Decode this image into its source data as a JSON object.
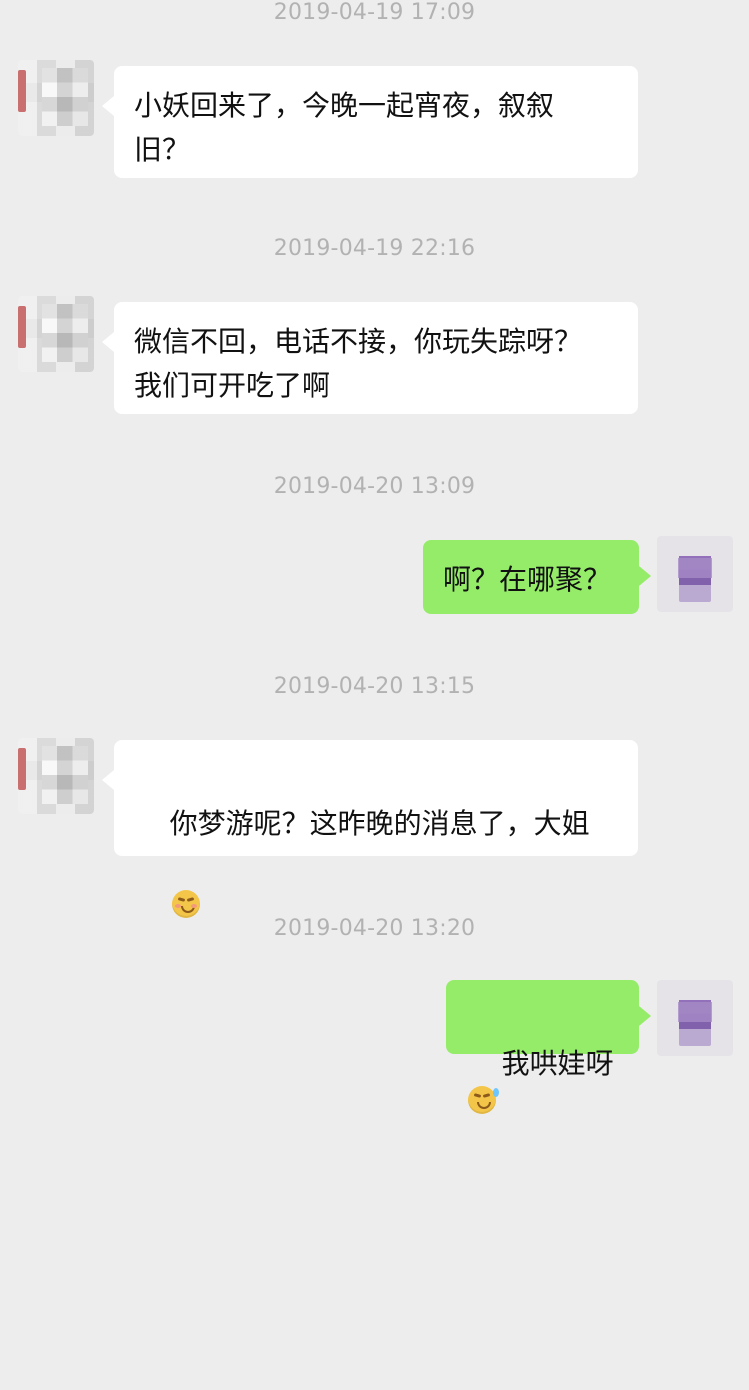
{
  "messages": [
    {
      "timestamp": "2019-04-19 17:09",
      "sender": "other",
      "text": "小妖回来了，今晚一起宵夜，叙叙\n旧？"
    },
    {
      "timestamp": "2019-04-19 22:16",
      "sender": "other",
      "text": "微信不回，电话不接，你玩失踪呀？\n我们可开吃了啊"
    },
    {
      "timestamp": "2019-04-20 13:09",
      "sender": "self",
      "text": "啊？在哪聚？"
    },
    {
      "timestamp": "2019-04-20 13:15",
      "sender": "other",
      "text": "你梦游呢？这昨晚的消息了，大姐",
      "emoji": "shy-face-icon"
    },
    {
      "timestamp": "2019-04-20 13:20",
      "sender": "self",
      "text": "我哄娃呀",
      "emoji": "sweat-face-icon"
    }
  ],
  "colors": {
    "background": "#ededed",
    "bubble_left": "#ffffff",
    "bubble_right": "#95ec69",
    "timestamp": "#b2b2b2",
    "text": "#111111"
  }
}
